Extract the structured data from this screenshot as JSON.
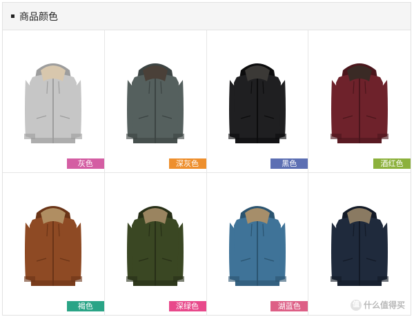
{
  "section": {
    "title": "商品颜色"
  },
  "products": [
    {
      "label": "灰色",
      "tag_color": "#d45ea3",
      "body": "#c6c6c6",
      "dark": "#9d9d9d",
      "lining": "#d8c7ad",
      "icon": "hoodie-icon"
    },
    {
      "label": "深灰色",
      "tag_color": "#ee8f2d",
      "body": "#55605e",
      "dark": "#3c4443",
      "lining": "#4a4038",
      "icon": "hoodie-icon"
    },
    {
      "label": "黑色",
      "tag_color": "#5c6fb3",
      "body": "#1f1f21",
      "dark": "#0c0c0d",
      "lining": "#3b3936",
      "icon": "hoodie-icon"
    },
    {
      "label": "酒红色",
      "tag_color": "#8cb13c",
      "body": "#6e222b",
      "dark": "#4b161c",
      "lining": "#3a2a25",
      "icon": "hoodie-icon"
    },
    {
      "label": "褐色",
      "tag_color": "#2aa486",
      "body": "#8e4a24",
      "dark": "#6a3417",
      "lining": "#b08e62",
      "icon": "hoodie-icon"
    },
    {
      "label": "深绿色",
      "tag_color": "#e8498b",
      "body": "#3a4723",
      "dark": "#272f17",
      "lining": "#9a8460",
      "icon": "hoodie-icon"
    },
    {
      "label": "湖蓝色",
      "tag_color": "#dd5f86",
      "body": "#3f7398",
      "dark": "#2b5470",
      "lining": "#a68e6a",
      "icon": "hoodie-icon"
    },
    {
      "label": "",
      "tag_color": "#9fc95e",
      "body": "#1f2a3c",
      "dark": "#131a27",
      "lining": "#8a7a62",
      "icon": "hoodie-icon"
    }
  ],
  "watermark": {
    "text": "什么值得买",
    "badge": "值"
  }
}
